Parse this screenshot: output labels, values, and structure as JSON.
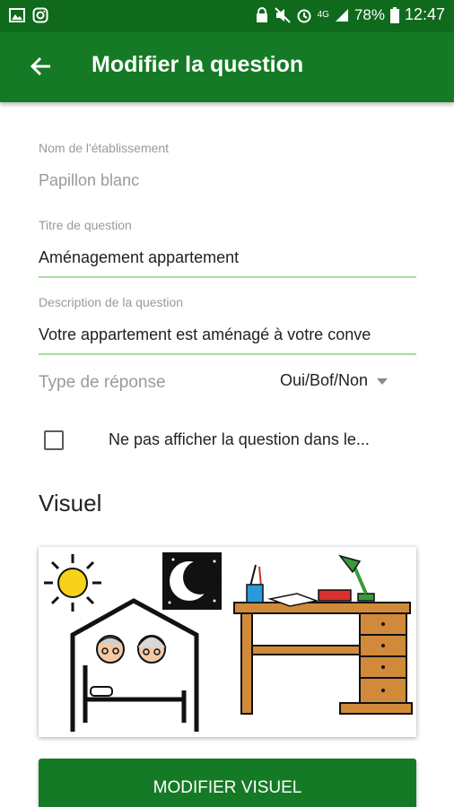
{
  "status_bar": {
    "battery": "78%",
    "time": "12:47",
    "network": "4G",
    "icons_left": [
      "image-icon",
      "instagram-icon"
    ],
    "icons_right": [
      "lock-icon",
      "mute-icon",
      "alarm-icon",
      "signal-icon",
      "battery-icon"
    ]
  },
  "app_bar": {
    "title": "Modifier la question",
    "back_icon": "arrow-left-icon",
    "color": "#157a25"
  },
  "form": {
    "establishment": {
      "label": "Nom de l'établissement",
      "value": "Papillon blanc"
    },
    "question_title": {
      "label": "Titre de question",
      "value": "Aménagement appartement"
    },
    "description": {
      "label": "Description de la question",
      "value": "Votre appartement est aménagé à votre conve"
    },
    "answer_type": {
      "label": "Type de réponse",
      "selected": "Oui/Bof/Non"
    },
    "hide_checkbox": {
      "checked": false,
      "label": "Ne pas afficher la question dans le..."
    }
  },
  "visual": {
    "heading": "Visuel",
    "image_icons": [
      "sun-icon",
      "moon-icon",
      "house-icon",
      "elderly-couple-icon",
      "bed-icon",
      "desk-icon",
      "lamp-icon",
      "book-icon",
      "pencil-cup-icon"
    ]
  },
  "button": {
    "label": "MODIFIER VISUEL"
  }
}
